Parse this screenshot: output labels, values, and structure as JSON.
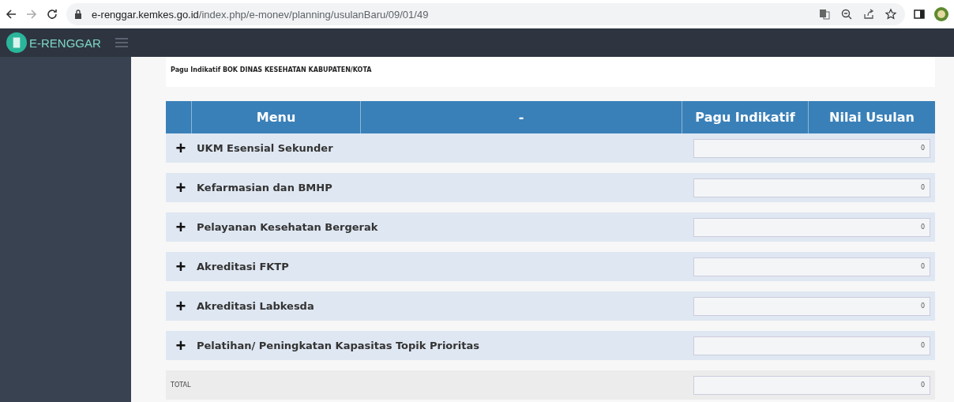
{
  "browser": {
    "url_host": "e-renggar.kemkes.go.id",
    "url_path": "/index.php/e-monev/planning/usulanBaru/09/01/49"
  },
  "app": {
    "logo": "E-RENGGAR"
  },
  "page_title": "Pagu Indikatif BOK DINAS KESEHATAN KABUPATEN/KOTA",
  "table": {
    "columns": [
      "Menu",
      "-",
      "Pagu Indikatif",
      "Nilai Usulan"
    ],
    "rows": [
      {
        "toggle": "+",
        "label": "UKM Esensial Sekunder",
        "value": "0"
      },
      {
        "toggle": "+",
        "label": "Kefarmasian dan BMHP",
        "value": "0"
      },
      {
        "toggle": "+",
        "label": "Pelayanan Kesehatan Bergerak",
        "value": "0"
      },
      {
        "toggle": "+",
        "label": "Akreditasi FKTP",
        "value": "0"
      },
      {
        "toggle": "+",
        "label": "Akreditasi Labkesda",
        "value": "0"
      },
      {
        "toggle": "+",
        "label": "Pelatihan/ Peningkatan Kapasitas Topik Prioritas",
        "value": "0"
      }
    ],
    "total": {
      "label": "TOTAL",
      "value": "0"
    }
  }
}
